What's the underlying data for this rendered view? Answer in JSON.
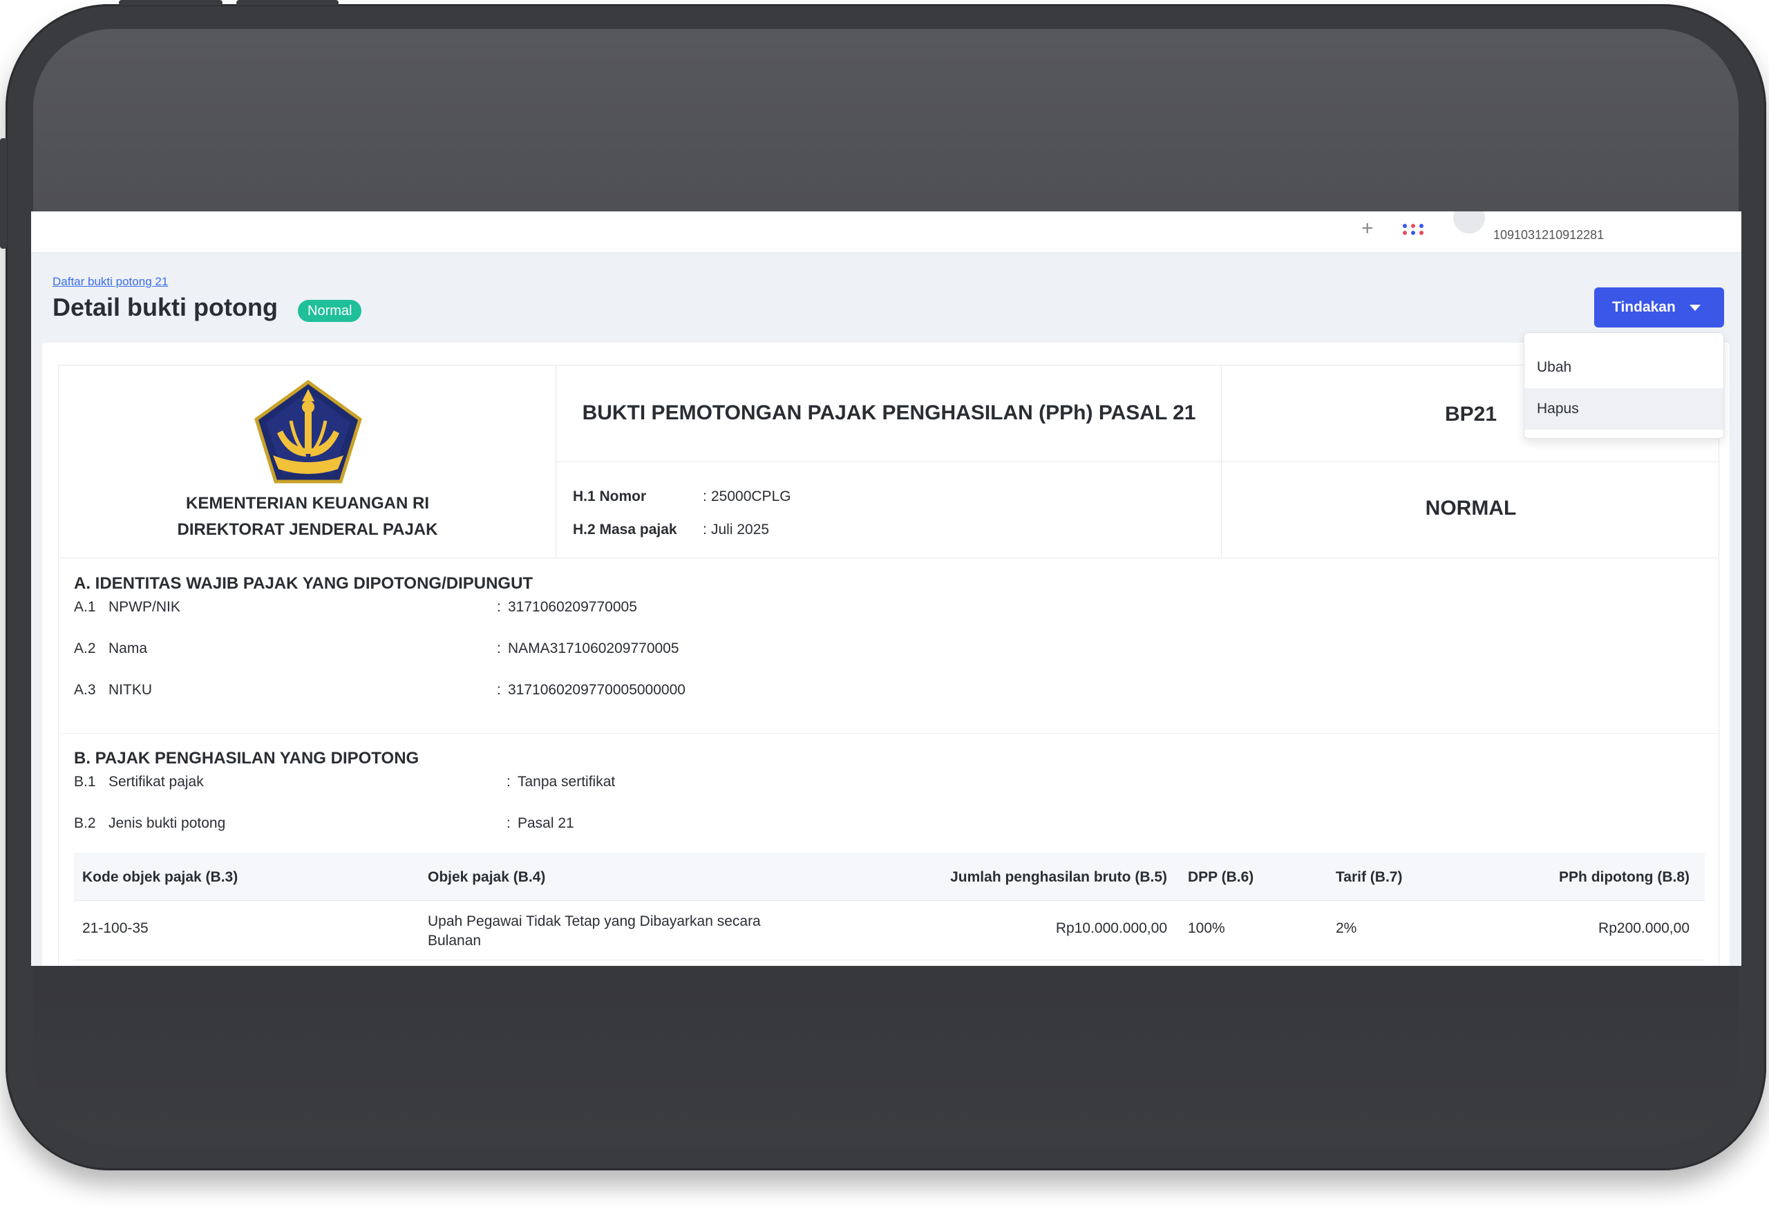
{
  "header": {
    "plus_icon": "plus-icon",
    "apps_icon": "apps-grid-icon",
    "user_id": "1091031210912281"
  },
  "breadcrumb": "Daftar bukti potong 21",
  "page": {
    "title": "Detail bukti potong",
    "status": "Normal"
  },
  "actions": {
    "button_label": "Tindakan",
    "menu": [
      "Ubah",
      "Hapus"
    ]
  },
  "document": {
    "ministry_line1": "KEMENTERIAN KEUANGAN RI",
    "ministry_line2": "DIREKTORAT JENDERAL PAJAK",
    "title": "BUKTI PEMOTONGAN PAJAK PENGHASILAN (PPh) PASAL 21",
    "code": "BP21",
    "status": "NORMAL",
    "h_fields": [
      {
        "label": "H.1 Nomor",
        "value": "25000CPLG"
      },
      {
        "label": "H.2 Masa pajak",
        "value": "Juli 2025"
      }
    ],
    "section_a": {
      "title": "A. IDENTITAS WAJIB PAJAK YANG DIPOTONG/DIPUNGUT",
      "fields": [
        {
          "code": "A.1",
          "label": "NPWP/NIK",
          "value": "3171060209770005"
        },
        {
          "code": "A.2",
          "label": "Nama",
          "value": "NAMA3171060209770005"
        },
        {
          "code": "A.3",
          "label": "NITKU",
          "value": "3171060209770005000000"
        }
      ]
    },
    "section_b": {
      "title": "B. PAJAK PENGHASILAN YANG DIPOTONG",
      "fields": [
        {
          "code": "B.1",
          "label": "Sertifikat pajak",
          "value": "Tanpa sertifikat"
        },
        {
          "code": "B.2",
          "label": "Jenis bukti potong",
          "value": "Pasal 21"
        }
      ]
    },
    "table": {
      "headers": [
        "Kode objek pajak (B.3)",
        "Objek pajak (B.4)",
        "Jumlah penghasilan bruto (B.5)",
        "DPP (B.6)",
        "Tarif (B.7)",
        "PPh dipotong (B.8)"
      ],
      "rows": [
        [
          "21-100-35",
          "Upah Pegawai Tidak Tetap yang Dibayarkan secara Bulanan",
          "Rp10.000.000,00",
          "100%",
          "2%",
          "Rp200.000,00"
        ]
      ]
    }
  },
  "colors": {
    "primary": "#3a57e8",
    "badge": "#1fbf9a",
    "link": "#3b6ee8",
    "frame": "#3a3b3e"
  }
}
